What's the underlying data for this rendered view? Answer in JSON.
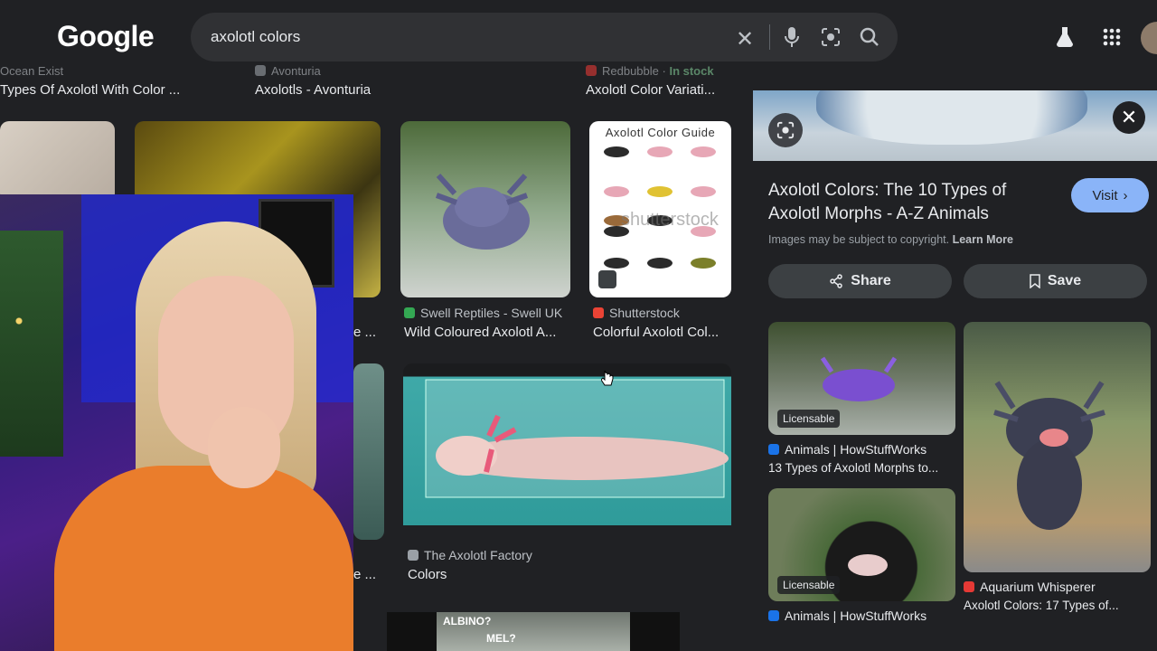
{
  "header": {
    "logo": "Google",
    "query": "axolotl colors",
    "icons": [
      "close-icon",
      "mic-icon",
      "lens-icon",
      "search-icon",
      "labs-icon",
      "apps-icon",
      "avatar"
    ]
  },
  "results_top_row": [
    {
      "source": "Ocean Exist",
      "title": "Types Of Axolotl With Color ..."
    },
    {
      "source": "Avonturia",
      "title": "Axolotls - Avonturia"
    },
    {
      "source": "Redbubble",
      "stock": "In stock",
      "title": "Axolotl Color Variati..."
    }
  ],
  "results_row2": [
    {
      "source": "Swell Reptiles - Swell UK",
      "title": "Wild Coloured Axolotl A..."
    },
    {
      "source": "Shutterstock",
      "title": "Colorful Axolotl Col...",
      "image_text": "Axolotl Color Guide",
      "watermark": "shutterstock"
    }
  ],
  "partial_titles": [
    "e ...",
    "e ..."
  ],
  "results_row3": [
    {
      "source": "The Axolotl Factory",
      "title": "Colors"
    }
  ],
  "bottom_image_text": [
    "ALBINO?",
    "MEL?"
  ],
  "panel": {
    "title": "Axolotl Colors: The 10 Types of Axolotl Morphs - A-Z Animals",
    "visit_label": "Visit",
    "copyright_text": "Images may be subject to copyright.",
    "learn_more": "Learn More",
    "share_label": "Share",
    "save_label": "Save",
    "related": [
      {
        "badge": "Licensable",
        "source": "Animals | HowStuffWorks",
        "title": "13 Types of Axolotl Morphs to..."
      },
      {
        "source": "Aquarium Whisperer",
        "title": "Axolotl Colors: 17 Types of..."
      },
      {
        "badge": "Licensable",
        "source": "Animals | HowStuffWorks"
      }
    ]
  },
  "colors": {
    "background": "#202124",
    "search_bg": "#303134",
    "visit_button": "#8ab4f8",
    "stock_green": "#81c995"
  }
}
